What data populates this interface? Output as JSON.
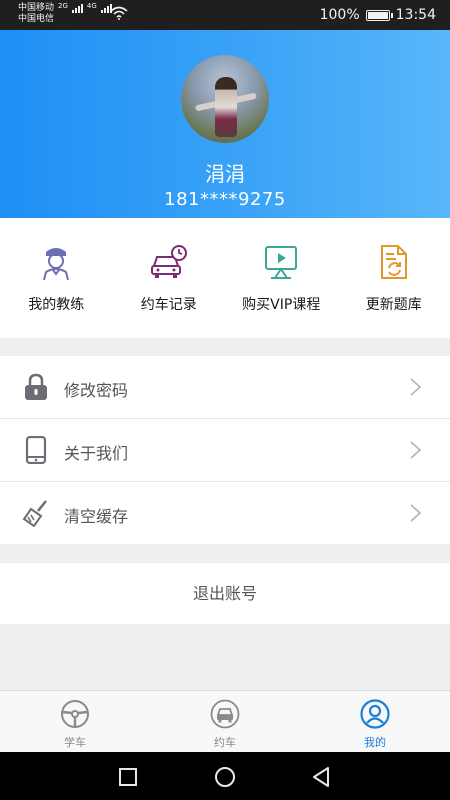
{
  "status_bar": {
    "carrier1": "中国移动",
    "carrier2": "中国电信",
    "net1": "2G",
    "net2": "4G",
    "battery": "100%",
    "battery_level": 1.0,
    "time": "13:54"
  },
  "profile": {
    "name": "涓涓",
    "phone": "181****9275"
  },
  "quick_actions": [
    {
      "label": "我的教练",
      "icon": "coach-icon",
      "color": "#6b6fb3"
    },
    {
      "label": "约车记录",
      "icon": "car-clock-icon",
      "color": "#7a2b74"
    },
    {
      "label": "购买VIP课程",
      "icon": "video-course-icon",
      "color": "#3aa894"
    },
    {
      "label": "更新题库",
      "icon": "refresh-document-icon",
      "color": "#e3962b"
    }
  ],
  "menu": [
    {
      "label": "修改密码",
      "icon": "lock-icon"
    },
    {
      "label": "关于我们",
      "icon": "phone-device-icon"
    },
    {
      "label": "清空缓存",
      "icon": "broom-icon"
    }
  ],
  "logout_label": "退出账号",
  "tabs": [
    {
      "label": "学车",
      "icon": "steering-wheel-icon",
      "active": false
    },
    {
      "label": "约车",
      "icon": "car-icon",
      "active": false
    },
    {
      "label": "我的",
      "icon": "user-icon",
      "active": true
    }
  ],
  "colors": {
    "accent": "#1b7fd6",
    "header_start": "#1f8ff5",
    "header_end": "#59b6f9"
  }
}
